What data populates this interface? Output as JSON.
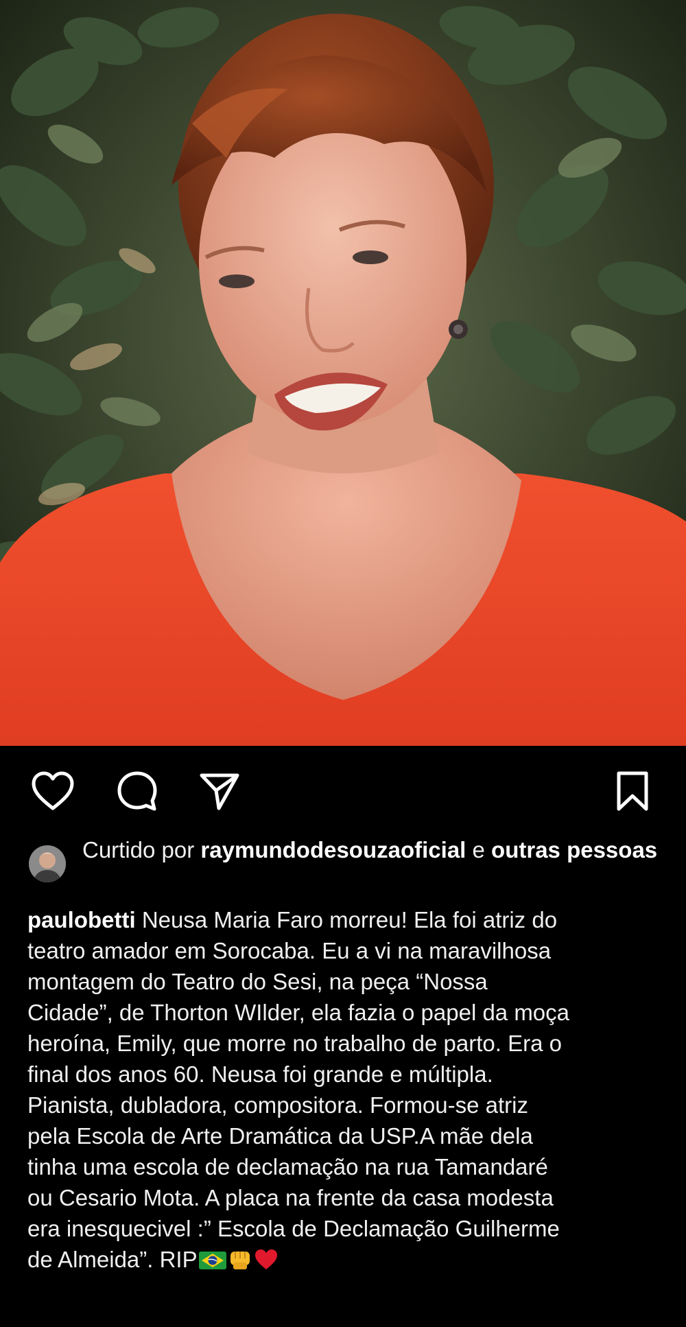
{
  "post": {
    "image_alt": "Portrait of a smiling woman with short auburn hair wearing a red top in front of green leaves",
    "actions": {
      "like_icon": "heart-outline",
      "comment_icon": "speech-bubble-outline",
      "share_icon": "paper-plane-outline",
      "save_icon": "bookmark-outline"
    },
    "likes": {
      "prefix": "Curtido por ",
      "user": "raymundodesouzaoficial",
      "connector": " e ",
      "others": "outras pessoas",
      "avatar_icon": "user-avatar"
    },
    "caption": {
      "username": "paulobetti",
      "lines": [
        " Neusa Maria Faro morreu! Ela foi atriz do",
        "teatro amador em Sorocaba. Eu a vi na maravilhosa",
        "montagem do Teatro do Sesi, na peça “Nossa",
        "Cidade”, de Thorton WIlder, ela fazia o papel da moça",
        "heroína, Emily, que morre no trabalho de parto. Era o",
        "final dos anos 60. Neusa foi grande e múltipla.",
        "Pianista, dubladora, compositora. Formou-se atriz",
        "pela Escola de Arte Dramática da USP.A mãe dela",
        "tinha uma escola de declamação na rua Tamandaré",
        "ou Cesario Mota. A placa na frente da casa modesta",
        "era inesquecivel :” Escola de Declamação Guilherme"
      ],
      "last_line": "de Almeida”. RIP",
      "emojis": [
        "flag-brazil",
        "fist",
        "red-heart"
      ]
    }
  },
  "colors": {
    "background": "#000000",
    "text": "#f0f0f0",
    "shirt": "#e8442a",
    "hair": "#8a3e1e",
    "foliage": "#3d5236"
  }
}
